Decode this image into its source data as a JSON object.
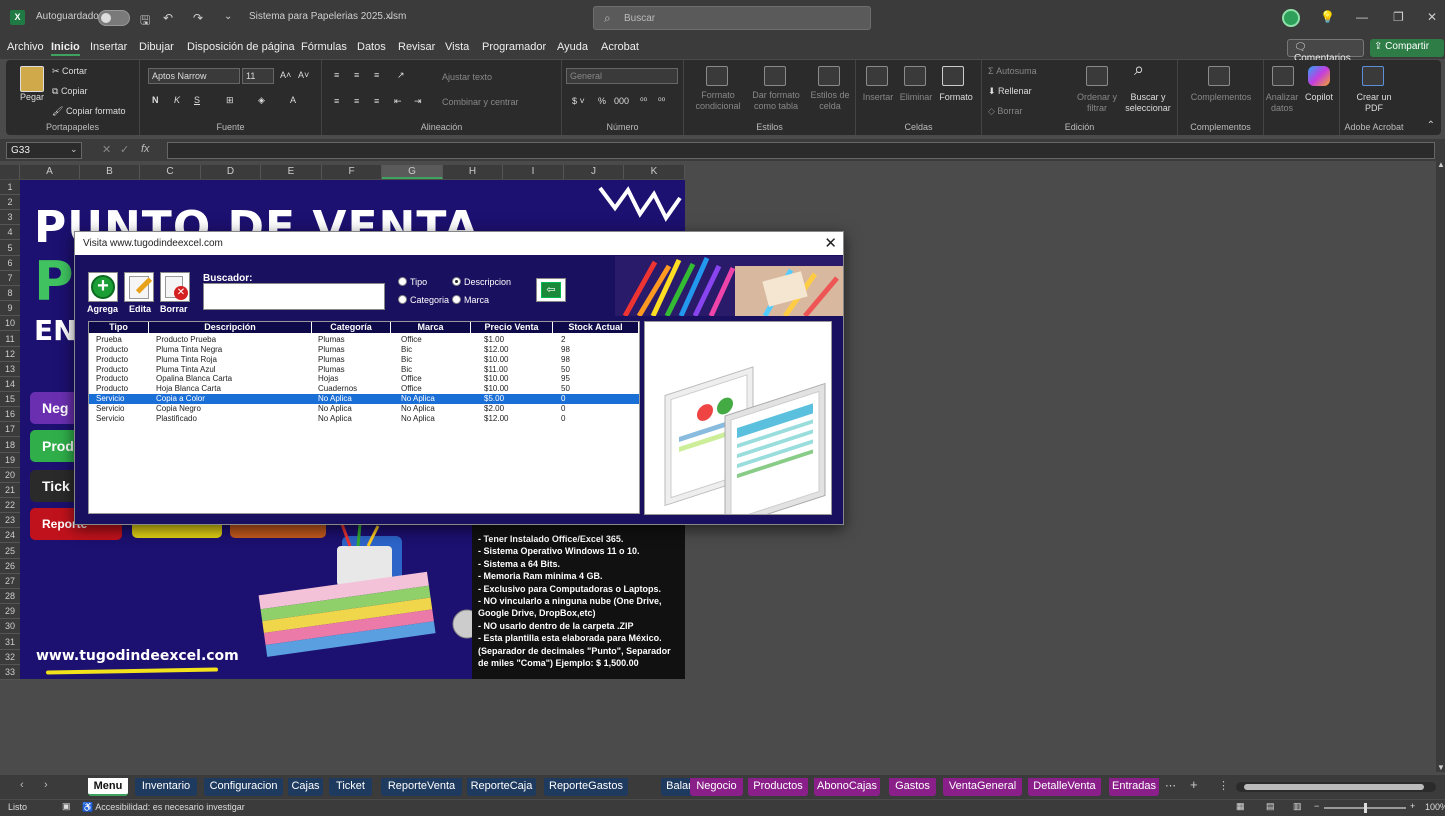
{
  "titlebar": {
    "autosave_label": "Autoguardado",
    "filename": "Sistema para Papelerias 2025.xlsm",
    "search_placeholder": "Buscar"
  },
  "menubar": {
    "items": [
      "Archivo",
      "Inicio",
      "Insertar",
      "Dibujar",
      "Disposición de página",
      "Fórmulas",
      "Datos",
      "Revisar",
      "Vista",
      "Programador",
      "Ayuda",
      "Acrobat"
    ],
    "active": "Inicio",
    "comments_label": "Comentarios",
    "share_label": "Compartir"
  },
  "ribbon": {
    "portapapeles": {
      "group": "Portapapeles",
      "paste": "Pegar",
      "cut": "Cortar",
      "copy": "Copiar",
      "format_painter": "Copiar formato"
    },
    "fuente": {
      "group": "Fuente",
      "font_name": "Aptos Narrow",
      "font_size": "11",
      "bold": "N",
      "italic": "K",
      "underline": "S"
    },
    "alineacion": {
      "group": "Alineación",
      "wrap": "Ajustar texto",
      "merge": "Combinar y centrar"
    },
    "numero": {
      "group": "Número",
      "format": "General"
    },
    "estilos": {
      "group": "Estilos",
      "conditional": "Formato condicional",
      "table": "Dar formato como tabla",
      "cell_styles": "Estilos de celda"
    },
    "celdas": {
      "group": "Celdas",
      "insert": "Insertar",
      "delete": "Eliminar",
      "format": "Formato"
    },
    "edicion": {
      "group": "Edición",
      "autosum": "Autosuma",
      "fill": "Rellenar",
      "clear": "Borrar",
      "sort": "Ordenar y filtrar",
      "find": "Buscar y seleccionar"
    },
    "complementos": {
      "group": "Complementos",
      "addins": "Complementos",
      "analyze": "Analizar datos",
      "copilot": "Copilot"
    },
    "acrobat": {
      "group": "Adobe Acrobat",
      "create_pdf": "Crear un PDF"
    }
  },
  "formula_bar": {
    "name_box": "G33",
    "fx": "fx",
    "value": ""
  },
  "grid": {
    "columns": [
      "A",
      "B",
      "C",
      "D",
      "E",
      "F",
      "G",
      "H",
      "I",
      "J",
      "K"
    ],
    "selected_column": "G",
    "rows": [
      "1",
      "2",
      "3",
      "4",
      "5",
      "6",
      "7",
      "8",
      "9",
      "10",
      "11",
      "12",
      "13",
      "14",
      "15",
      "16",
      "17",
      "18",
      "19",
      "20",
      "21",
      "22",
      "23",
      "24",
      "25",
      "26",
      "27",
      "28",
      "29",
      "30",
      "31",
      "32",
      "33"
    ]
  },
  "sheet": {
    "title_line": "PUNTO DE VENTA",
    "title_fragment_2": "P",
    "title_fragment_3": "EN",
    "buttons": [
      "Neg",
      "Prod",
      "Tick",
      "Reporte"
    ],
    "requirements": [
      "- Tener Instalado Office/Excel 365.",
      "- Sistema Operativo Windows 11 o 10.",
      "- Sistema a 64 Bits.",
      "- Memoria Ram minima 4 GB.",
      "- Exclusivo para Computadoras o Laptops.",
      "- NO vincularlo a ninguna nube (One Drive, Google Drive, DropBox,etc)",
      "- NO usarlo dentro de la carpeta .ZIP",
      "- Esta plantilla esta elaborada para México. (Separador de decimales \"Punto\", Separador de miles \"Coma\") Ejemplo: $ 1,500.00"
    ],
    "url": "www.tugodindeexcel.com"
  },
  "dialog": {
    "title": "Visita www.tugodindeexcel.com",
    "close": "✕",
    "tools": [
      {
        "label": "Agrega",
        "icon": "plus-icon"
      },
      {
        "label": "Edita",
        "icon": "pencil-icon"
      },
      {
        "label": "Borrar",
        "icon": "delete-doc-icon"
      }
    ],
    "search_label": "Buscador:",
    "search_value": "",
    "radios": [
      {
        "label": "Tipo",
        "checked": false
      },
      {
        "label": "Descripcion",
        "checked": true
      },
      {
        "label": "Categoria",
        "checked": false
      },
      {
        "label": "Marca",
        "checked": false
      }
    ],
    "back_icon": "back-arrow-icon",
    "list": {
      "headers": [
        "Tipo",
        "Descripción",
        "Categoría",
        "Marca",
        "Precio Venta",
        "Stock Actual"
      ],
      "rows": [
        [
          "Prueba",
          "Producto Prueba",
          "Plumas",
          "Office",
          "$1.00",
          "2"
        ],
        [
          "Producto",
          "Pluma Tinta Negra",
          "Plumas",
          "Bic",
          "$12.00",
          "98"
        ],
        [
          "Producto",
          "Pluma Tinta Roja",
          "Plumas",
          "Bic",
          "$10.00",
          "98"
        ],
        [
          "Producto",
          "Pluma Tinta Azul",
          "Plumas",
          "Bic",
          "$11.00",
          "50"
        ],
        [
          "Producto",
          "Opalina Blanca Carta",
          "Hojas",
          "Office",
          "$10.00",
          "95"
        ],
        [
          "Producto",
          "Hoja Blanca Carta",
          "Cuadernos",
          "Office",
          "$10.00",
          "50"
        ],
        [
          "Servicio",
          "Copia a Color",
          "No Aplica",
          "No Aplica",
          "$5.00",
          "0"
        ],
        [
          "Servicio",
          "Copia Negro",
          "No Aplica",
          "No Aplica",
          "$2.00",
          "0"
        ],
        [
          "Servicio",
          "Plastificado",
          "No Aplica",
          "No Aplica",
          "$12.00",
          "0"
        ]
      ],
      "selected_row": 6
    }
  },
  "tabs": [
    {
      "label": "Menu",
      "style": "active"
    },
    {
      "label": "Inventario",
      "style": "blue"
    },
    {
      "label": "Configuracion",
      "style": "blue"
    },
    {
      "label": "Cajas",
      "style": "blue"
    },
    {
      "label": "Ticket",
      "style": "blue"
    },
    {
      "label": "ReporteVenta",
      "style": "blue"
    },
    {
      "label": "ReporteCaja",
      "style": "blue"
    },
    {
      "label": "ReporteGastos",
      "style": "blue"
    },
    {
      "label": "Balance",
      "style": "blue"
    },
    {
      "label": "Negocio",
      "style": "pink"
    },
    {
      "label": "Productos",
      "style": "pink"
    },
    {
      "label": "AbonoCajas",
      "style": "pink"
    },
    {
      "label": "Gastos",
      "style": "pink"
    },
    {
      "label": "VentaGeneral",
      "style": "pink"
    },
    {
      "label": "DetalleVenta",
      "style": "pink"
    },
    {
      "label": "Entradas",
      "style": "pink"
    }
  ],
  "statusbar": {
    "ready": "Listo",
    "accessibility": "Accesibilidad: es necesario investigar",
    "zoom": "100%"
  },
  "colors": {
    "accent_green": "#3fa25f",
    "sheet_navy": "#1c1070",
    "selection_blue": "#1a6fd6",
    "tab_blue": "#1e3a5f",
    "tab_pink": "#8a1f8a"
  }
}
